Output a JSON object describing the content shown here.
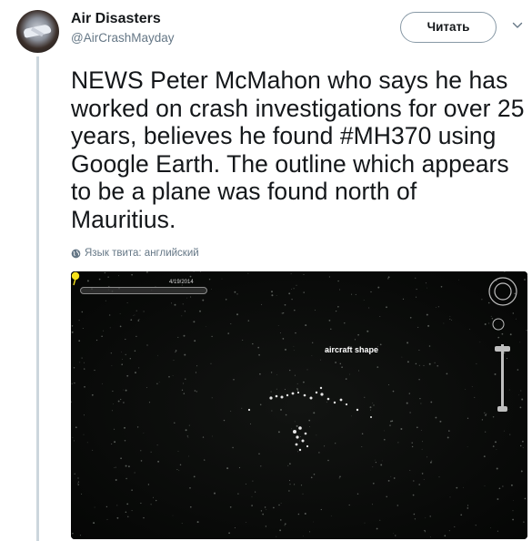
{
  "author": {
    "display_name": "Air Disasters",
    "handle": "@AirCrashMayday",
    "avatar_icon": "plane-crash-avatar"
  },
  "follow_button": {
    "label": "Читать"
  },
  "menu": {
    "icon": "chevron-down-icon"
  },
  "tweet": {
    "text_before": "NEWS Peter McMahon who says he has worked on crash investigations for over 25 years, believes he found ",
    "hashtag": "#MH370",
    "text_after": " using Google Earth. The outline which appears to be a plane was found north of Mauritius.",
    "language_note": "Язык твита: английский"
  },
  "media": {
    "date_label": "4/19/2014",
    "pin_label": "aircraft shape",
    "pin_color": "#f5e11a"
  },
  "colors": {
    "text": "#14171a",
    "secondary": "#657786",
    "thread_line": "#ccd6dd"
  }
}
